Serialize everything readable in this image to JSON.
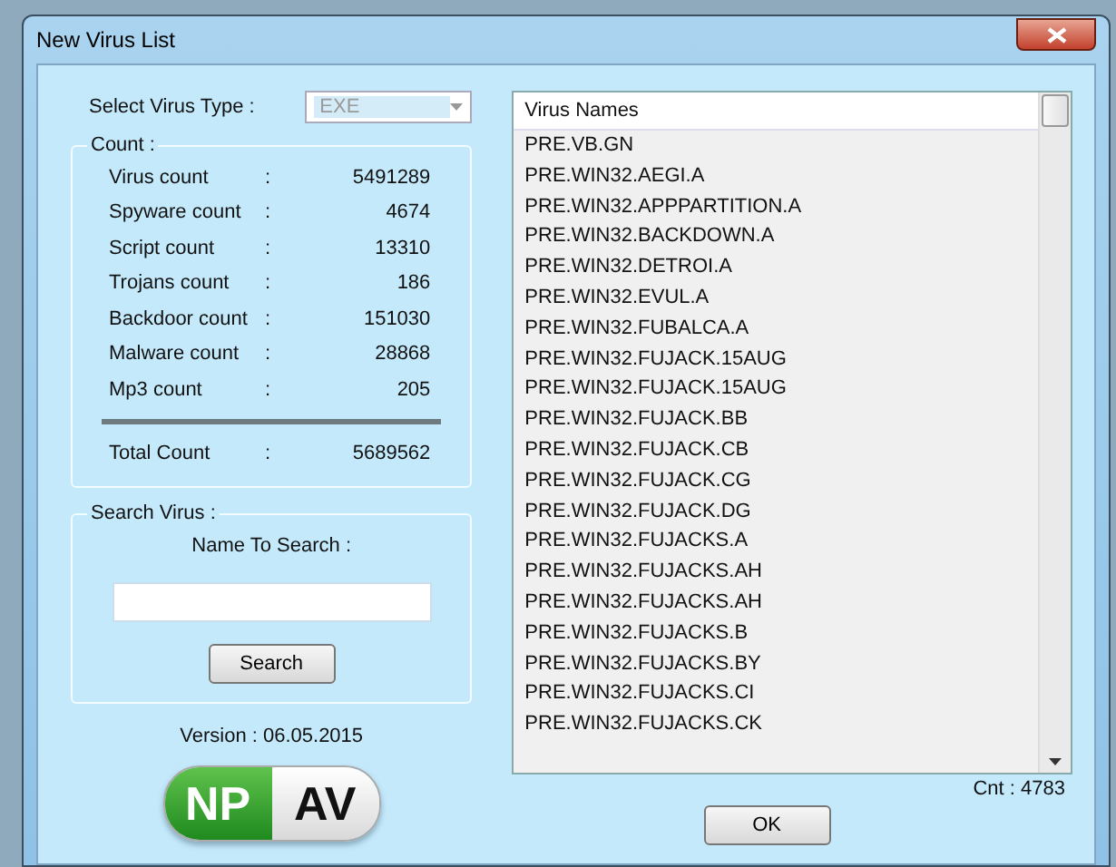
{
  "window": {
    "title": "New Virus List"
  },
  "virus_type": {
    "label": "Select Virus Type :",
    "value": "EXE",
    "disabled": true
  },
  "count": {
    "legend": "Count :",
    "rows": [
      {
        "label": "Virus count",
        "sep": ":",
        "value": "5491289"
      },
      {
        "label": "Spyware count",
        "sep": ":",
        "value": "4674"
      },
      {
        "label": "Script count",
        "sep": ":",
        "value": "13310"
      },
      {
        "label": "Trojans count",
        "sep": ":",
        "value": "186"
      },
      {
        "label": "Backdoor count",
        "sep": ":",
        "value": "151030"
      },
      {
        "label": "Malware count",
        "sep": ":",
        "value": "28868"
      },
      {
        "label": "Mp3 count",
        "sep": ":",
        "value": "205"
      }
    ],
    "total": {
      "label": "Total Count",
      "sep": ":",
      "value": "5689562"
    }
  },
  "search": {
    "legend": "Search Virus :",
    "label": "Name To Search :",
    "button": "Search"
  },
  "version": "Version : 06.05.2015",
  "logo": {
    "left": "NP",
    "right": "AV"
  },
  "list": {
    "column": "Virus Names",
    "items": [
      "PRE.VB.GN",
      "PRE.WIN32.AEGI.A",
      "PRE.WIN32.APPPARTITION.A",
      "PRE.WIN32.BACKDOWN.A",
      "PRE.WIN32.DETROI.A",
      "PRE.WIN32.EVUL.A",
      "PRE.WIN32.FUBALCA.A",
      "PRE.WIN32.FUJACK.15AUG",
      "PRE.WIN32.FUJACK.15AUG",
      "PRE.WIN32.FUJACK.BB",
      "PRE.WIN32.FUJACK.CB",
      "PRE.WIN32.FUJACK.CG",
      "PRE.WIN32.FUJACK.DG",
      "PRE.WIN32.FUJACKS.A",
      "PRE.WIN32.FUJACKS.AH",
      "PRE.WIN32.FUJACKS.AH",
      "PRE.WIN32.FUJACKS.B",
      "PRE.WIN32.FUJACKS.BY",
      "PRE.WIN32.FUJACKS.CI",
      "PRE.WIN32.FUJACKS.CK"
    ],
    "count": "Cnt : 4783"
  },
  "ok_button": "OK"
}
